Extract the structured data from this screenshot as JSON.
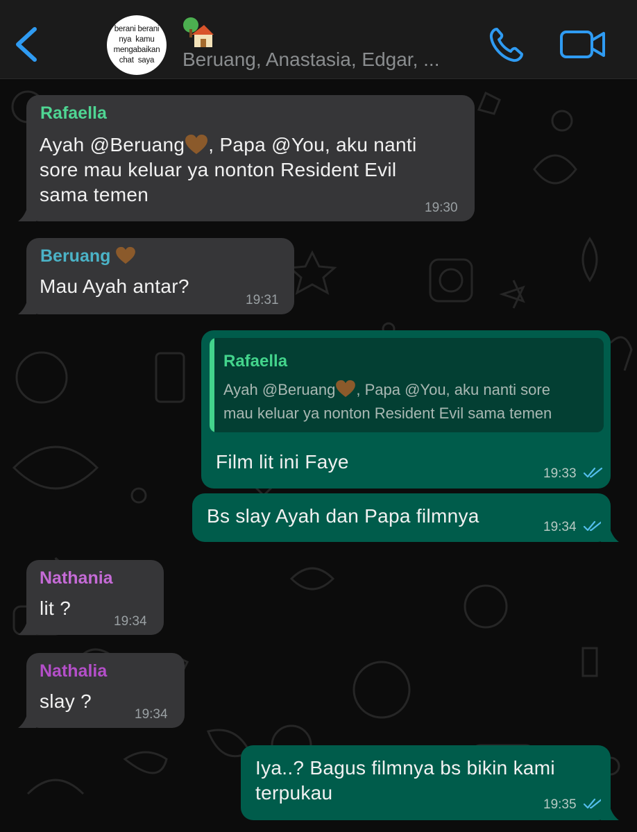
{
  "header": {
    "avatar_lines": [
      "berani berani",
      "nya  kamu",
      "mengabaikan",
      "chat  saya"
    ],
    "group_emoji": "house-with-tree-icon",
    "group_members": "Beruang, Anastasia, Edgar, ...",
    "icons": {
      "back": "chevron-left-icon",
      "call": "phone-icon",
      "video": "video-camera-icon"
    },
    "accent_color": "#2f9bf2"
  },
  "messages": [
    {
      "direction": "incoming",
      "sender": "Rafaella",
      "sender_color": "#4fd693",
      "lines": [
        "Ayah @Beruang",
        ", Papa @You, aku nanti",
        "sore mau keluar ya nonton Resident Evil",
        "sama temen"
      ],
      "time": "19:30"
    },
    {
      "direction": "incoming",
      "sender": "Beruang",
      "sender_color": "#4bb3c7",
      "lines": [
        "Mau Ayah antar?"
      ],
      "time": "19:31"
    },
    {
      "direction": "outgoing",
      "quoted": {
        "sender": "Rafaella",
        "lines": [
          "Ayah @Beruang",
          ", Papa @You, aku nanti sore",
          "mau keluar ya nonton Resident Evil sama temen"
        ]
      },
      "lines": [
        "Film lit ini Faye"
      ],
      "time": "19:33",
      "status": "read"
    },
    {
      "direction": "outgoing",
      "lines": [
        "Bs slay Ayah dan Papa filmnya"
      ],
      "time": "19:34",
      "status": "read"
    },
    {
      "direction": "incoming",
      "sender": "Nathania",
      "sender_color": "#c56bd6",
      "lines": [
        "lit ?"
      ],
      "time": "19:34"
    },
    {
      "direction": "incoming",
      "sender": "Nathalia",
      "sender_color": "#b44fc9",
      "lines": [
        "slay ?"
      ],
      "time": "19:34"
    },
    {
      "direction": "outgoing",
      "lines": [
        "Iya..? Bagus filmnya bs bikin kami",
        "terpukau"
      ],
      "time": "19:35",
      "status": "read"
    }
  ],
  "colors": {
    "incoming_bubble": "#363638",
    "outgoing_bubble": "#005c4b",
    "read_ticks": "#53bdeb",
    "heart": "#8b5a2b"
  }
}
